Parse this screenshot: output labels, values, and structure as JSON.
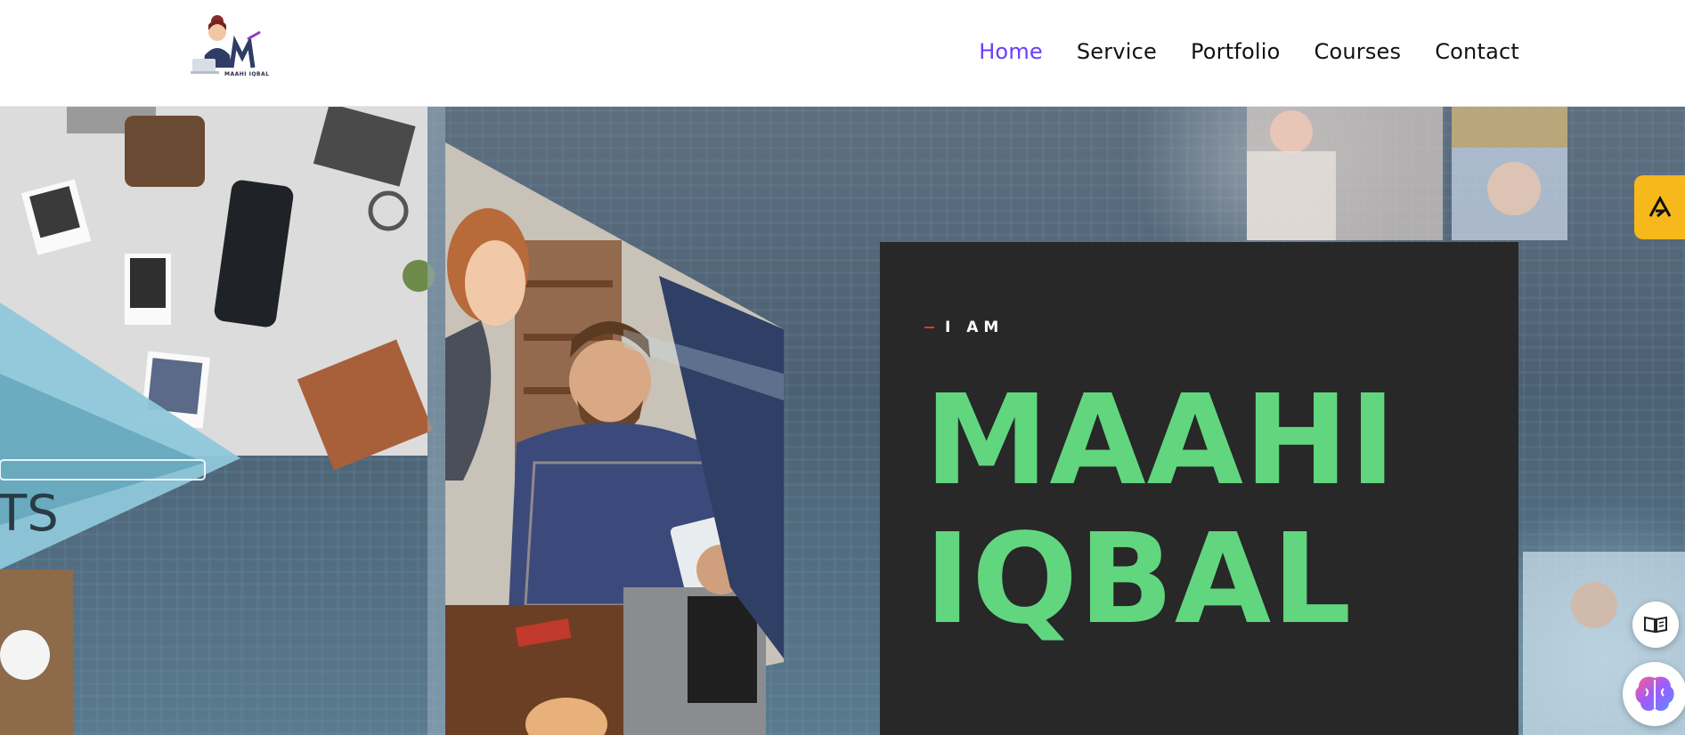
{
  "brand": {
    "logo_text": "MAAHI IQBAL"
  },
  "nav": {
    "items": [
      {
        "label": "Home",
        "active": true
      },
      {
        "label": "Service",
        "active": false
      },
      {
        "label": "Portfolio",
        "active": false
      },
      {
        "label": "Courses",
        "active": false
      },
      {
        "label": "Contact",
        "active": false
      }
    ]
  },
  "hero": {
    "eyebrow": "I AM",
    "name_line1": "MAAHI",
    "name_line2": "IQBAL",
    "collage_text": "TS"
  },
  "colors": {
    "nav_active": "#6a3cff",
    "name": "#62d57f",
    "card_bg": "#282828",
    "eyebrow_dash": "#e0343a",
    "side_tab": "#f7b81b"
  },
  "icons": {
    "side_tab": "mountain-logo-icon",
    "book_button": "book-open-icon",
    "ai_button": "brain-icon"
  }
}
